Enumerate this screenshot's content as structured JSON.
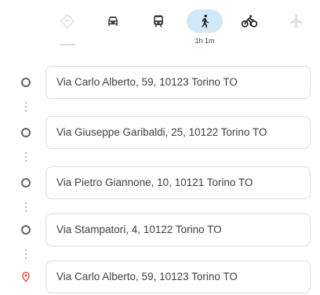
{
  "travel_modes": [
    {
      "icon": "best-route-icon",
      "duration": "",
      "active": false,
      "disabled": true
    },
    {
      "icon": "car-icon",
      "duration": "",
      "active": false
    },
    {
      "icon": "transit-icon",
      "duration": "",
      "active": false
    },
    {
      "icon": "walking-icon",
      "duration": "1h 1m",
      "active": true
    },
    {
      "icon": "bicycle-icon",
      "duration": "",
      "active": false
    },
    {
      "icon": "flight-icon",
      "duration": "",
      "active": false,
      "disabled": true
    }
  ],
  "waypoints": [
    {
      "value": "Via Carlo Alberto, 59, 10123 Torino TO",
      "marker": "circle"
    },
    {
      "value": "Via Giuseppe Garibaldi, 25, 10122 Torino TO",
      "marker": "circle"
    },
    {
      "value": "Via Pietro Giannone, 10, 10121 Torino TO",
      "marker": "circle"
    },
    {
      "value": "Via Stampatori, 4, 10122 Torino TO",
      "marker": "circle"
    },
    {
      "value": "Via Carlo Alberto, 59, 10123 Torino TO",
      "marker": "destination-pin"
    }
  ],
  "colors": {
    "active_mode_bg": "#d2e8f7",
    "icon": "#3c4043",
    "disabled_icon": "#dadce0",
    "destination_pin": "#ea4335"
  }
}
